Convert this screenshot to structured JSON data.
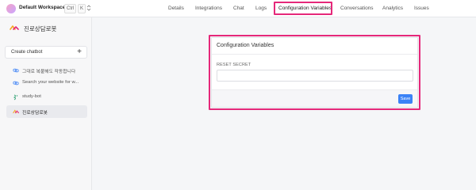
{
  "workspace": {
    "name": "Default Workspace",
    "shortcut_ctrl": "Ctrl",
    "shortcut_key": "K"
  },
  "tabs": [
    {
      "label": "Details"
    },
    {
      "label": "Integrations"
    },
    {
      "label": "Chat"
    },
    {
      "label": "Logs"
    },
    {
      "label": "Configuration Variables",
      "active": true
    },
    {
      "label": "Conversations"
    },
    {
      "label": "Analytics"
    },
    {
      "label": "Issues"
    }
  ],
  "sidebar": {
    "brand_name": "진로상담로봇",
    "create_label": "Create chatbot",
    "create_icon": "+",
    "items": [
      {
        "label": "그대로 복붙해도 작동합니다",
        "icon": "link-icon"
      },
      {
        "label": "Search your website for w...",
        "icon": "link-icon"
      },
      {
        "label": "study-bot",
        "icon": "bot-icon"
      },
      {
        "label": "진로상담로봇",
        "icon": "brand-icon",
        "selected": true
      }
    ]
  },
  "panel": {
    "title": "Configuration Variables",
    "field_label": "RESET SECRET",
    "field_value": "",
    "save_label": "Save"
  },
  "colors": {
    "highlight": "#e5287a",
    "accent": "#3b82f6"
  }
}
